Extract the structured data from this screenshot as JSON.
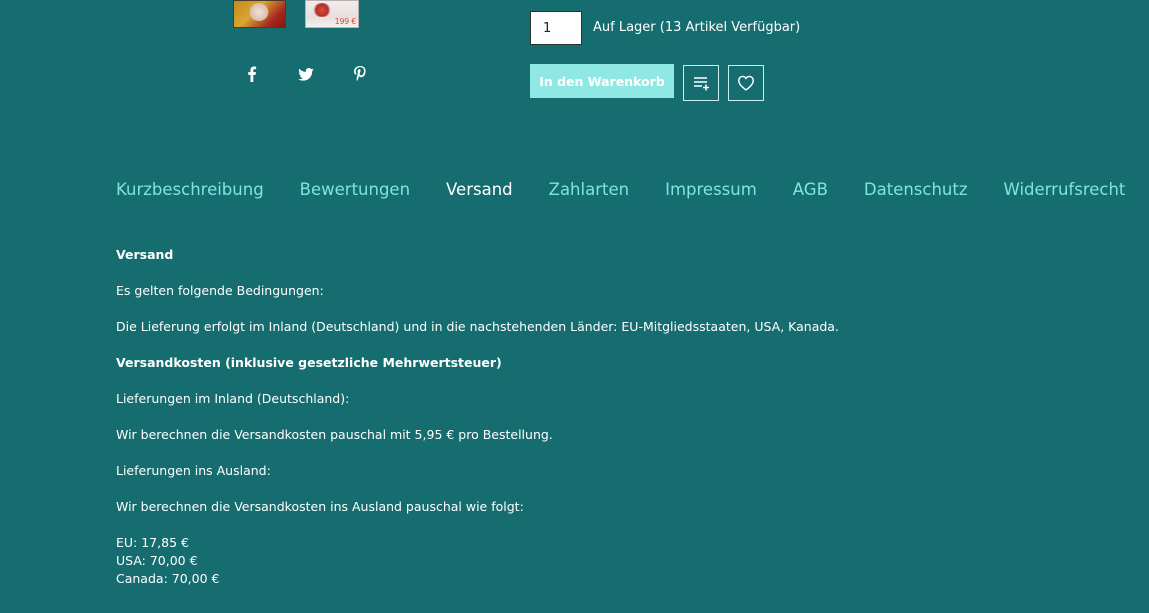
{
  "product": {
    "thumbnail_2_price": "199 €",
    "quantity": "1",
    "stock": "Auf Lager (13 Artikel Verfügbar)",
    "cart_button": "In den Warenkorb"
  },
  "social": {
    "icons": [
      "facebook-icon",
      "twitter-icon",
      "pinterest-icon"
    ]
  },
  "tabs": [
    {
      "label": "Kurzbeschreibung"
    },
    {
      "label": "Bewertungen"
    },
    {
      "label": "Versand"
    },
    {
      "label": "Zahlarten"
    },
    {
      "label": "Impressum"
    },
    {
      "label": "AGB"
    },
    {
      "label": "Datenschutz"
    },
    {
      "label": "Widerrufsrecht"
    }
  ],
  "active_tab": "Versand",
  "shipping": {
    "heading": "Versand",
    "conditions": "Es gelten folgende Bedingungen:",
    "delivery": "Die Lieferung erfolgt im Inland (Deutschland) und in die nachstehenden Länder: EU-Mitgliedsstaaten, USA, Kanada.",
    "costs_heading": "Versandkosten (inklusive gesetzliche Mehrwertsteuer)",
    "domestic_heading": "Lieferungen im Inland (Deutschland):",
    "domestic_text": "Wir berechnen die Versandkosten pauschal mit 5,95 € pro Bestellung.",
    "abroad_heading": "Lieferungen ins Ausland:",
    "abroad_text": "Wir berechnen die Versandkosten ins Ausland pauschal wie folgt:",
    "rates": [
      "EU: 17,85 €",
      "USA: 70,00 €",
      "Canada: 70,00 €"
    ]
  },
  "colors": {
    "background": "#166d70",
    "accent": "#7de6df",
    "button": "#8fe8e4"
  }
}
